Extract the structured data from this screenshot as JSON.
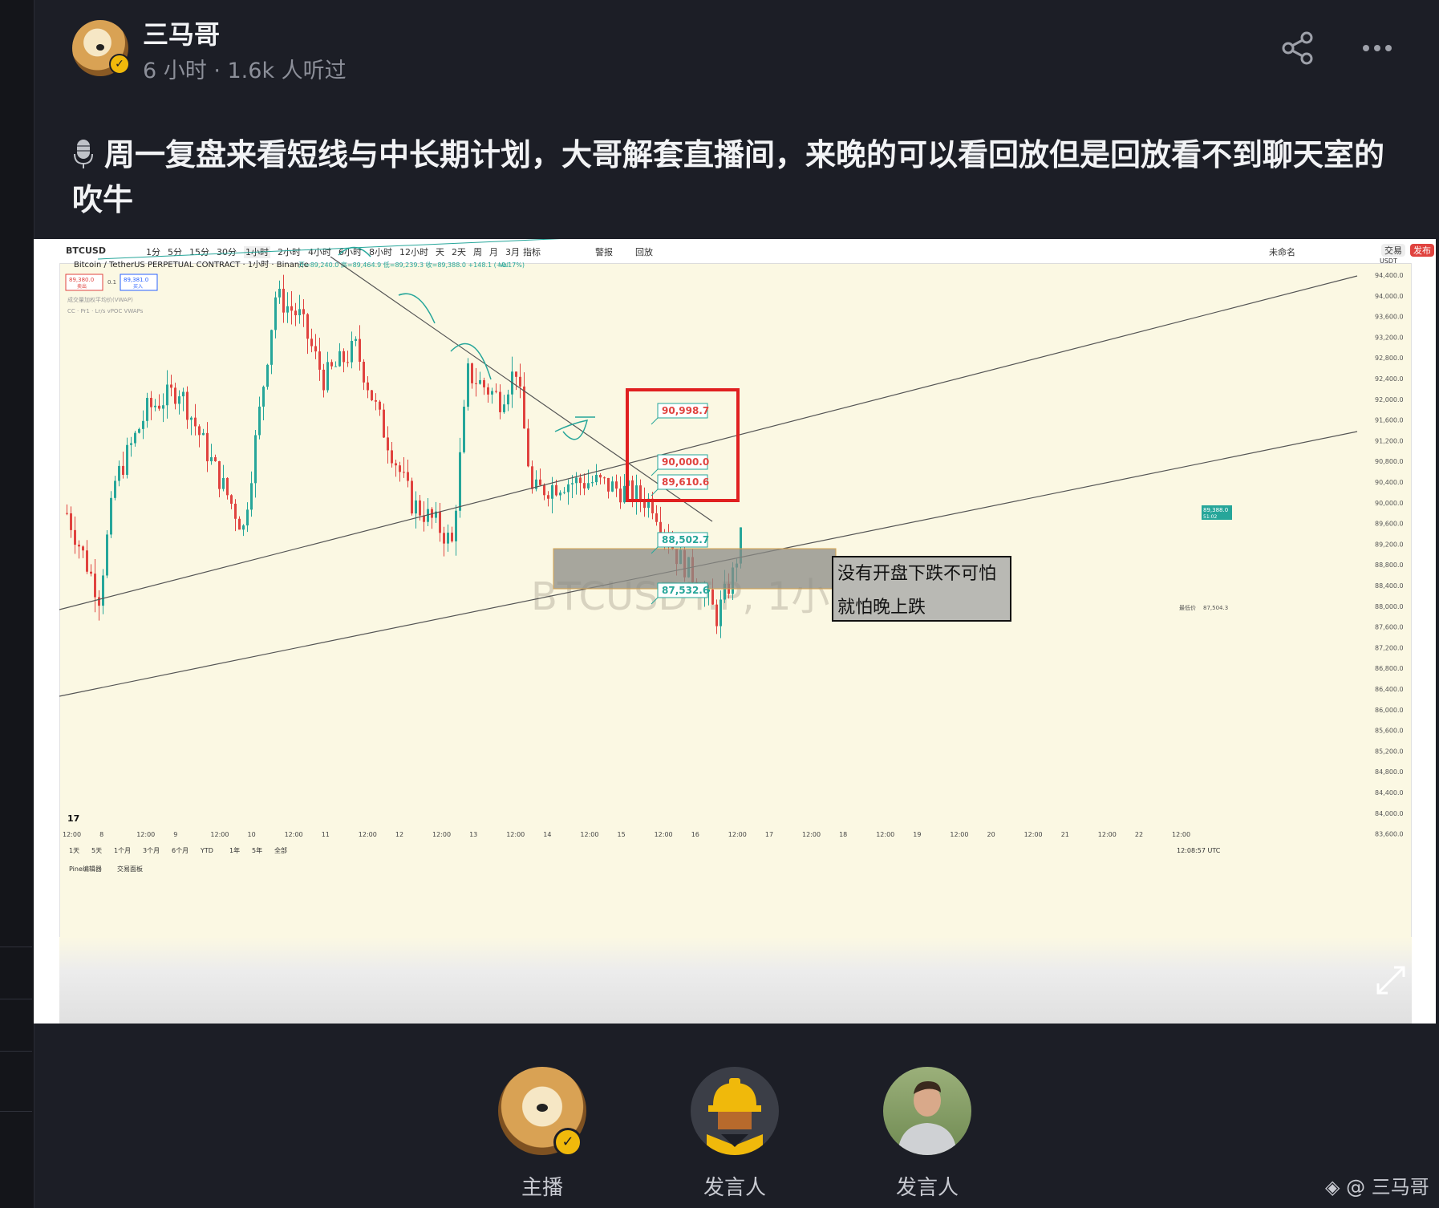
{
  "post": {
    "host_name": "三马哥",
    "meta": "6 小时 · 1.6k 人听过",
    "title": "周一复盘来看短线与中长期计划，大哥解套直播间，来晚的可以看回放但是回放看不到聊天室的吹牛"
  },
  "chart": {
    "symbol": "BTCUSD",
    "timeframes": [
      "1分",
      "5分",
      "15分",
      "30分",
      "1小时",
      "2小时",
      "4小时",
      "6小时",
      "8小时",
      "12小时",
      "天",
      "2天",
      "周",
      "月",
      "3月"
    ],
    "indicators_label": "指标",
    "alert_label": "警报",
    "replay_label": "回放",
    "unnamed_label": "未命名",
    "trade_label": "交易",
    "publish_label": "发布",
    "instrument": "Bitcoin / TetherUS PERPETUAL CONTRACT · 1小时 · Binance",
    "ohlc": "开=89,240.0 高=89,464.9 低=89,239.3 收=89,388.0 +148.1 (+0.17%)",
    "volume_label": "Vol",
    "sell_price": "89,380.0",
    "sell_label": "卖出",
    "spread": "0.1",
    "buy_price": "89,381.0",
    "buy_label": "买入",
    "indicator_line1": "成交量加权平均价(VWAP)",
    "indicator_line2": "CC · Pr1 · Lr/s vPOC VWAPs",
    "watermark": "BTCUSDT.P, 1小时",
    "currency_label": "USDT",
    "price_axis": [
      "94,400.0",
      "94,000.0",
      "93,600.0",
      "93,200.0",
      "92,800.0",
      "92,400.0",
      "92,000.0",
      "91,600.0",
      "91,200.0",
      "90,800.0",
      "90,400.0",
      "90,000.0",
      "89,600.0",
      "89,200.0",
      "88,800.0",
      "88,400.0",
      "88,000.0",
      "87,600.0",
      "87,200.0",
      "86,800.0",
      "86,400.0",
      "86,000.0",
      "85,600.0",
      "85,200.0",
      "84,800.0",
      "84,400.0",
      "84,000.0",
      "83,600.0"
    ],
    "current_price": "89,388.0",
    "current_countdown": "51:02",
    "low_marker_label": "最低价",
    "low_marker_value": "87,504.3",
    "labels": [
      {
        "text": "90,998.7",
        "color": "#e0433f"
      },
      {
        "text": "90,000.0",
        "color": "#e0433f"
      },
      {
        "text": "89,610.6",
        "color": "#e0433f"
      },
      {
        "text": "88,502.7",
        "color": "#26a69a"
      },
      {
        "text": "87,532.6",
        "color": "#26a69a"
      }
    ],
    "annotation_line1": "没有开盘下跌不可怕",
    "annotation_line2": "就怕晚上跌",
    "time_axis": [
      "12:00",
      "8",
      "12:00",
      "9",
      "12:00",
      "10",
      "12:00",
      "11",
      "12:00",
      "12",
      "12:00",
      "13",
      "12:00",
      "14",
      "12:00",
      "15",
      "12:00",
      "16",
      "12:00",
      "17",
      "12:00",
      "18",
      "12:00",
      "19",
      "12:00",
      "20",
      "12:00",
      "21",
      "12:00",
      "22",
      "12:00"
    ],
    "ranges": [
      "1天",
      "5天",
      "1个月",
      "3个月",
      "6个月",
      "YTD",
      "1年",
      "5年",
      "全部"
    ],
    "clock": "12:08:57 UTC",
    "panel_tab1": "Pine编辑器",
    "panel_tab2": "交易面板",
    "tv_logo": "17"
  },
  "participants": [
    {
      "label": "主播",
      "role": "host"
    },
    {
      "label": "发言人",
      "role": "speaker"
    },
    {
      "label": "发言人",
      "role": "speaker"
    }
  ],
  "footer": {
    "watermark": "@ 三马哥"
  },
  "colors": {
    "background": "#1c1e26",
    "accent": "#f0b90b",
    "up": "#26a69a",
    "down": "#e0433f",
    "highlight_box": "#e02020"
  }
}
